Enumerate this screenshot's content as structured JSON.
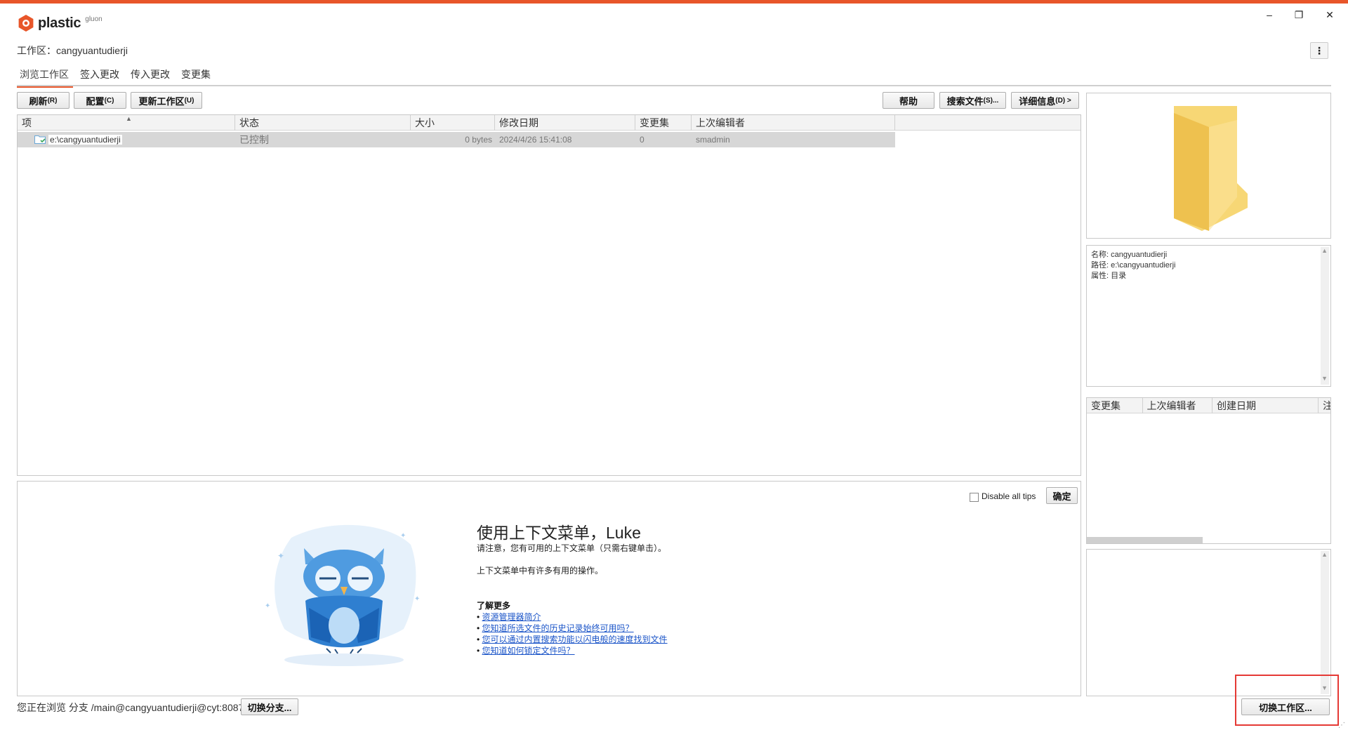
{
  "colors": {
    "accent": "#e8562a",
    "link": "#1a54c8",
    "highlight": "#e53935"
  },
  "app": {
    "logo_text": "plastic",
    "logo_sup": "gluon"
  },
  "window_controls": {
    "minimize": "–",
    "restore": "❐",
    "close": "✕"
  },
  "workspace": {
    "label": "工作区：",
    "name": "cangyuantudierji"
  },
  "tabs": [
    "浏览工作区",
    "签入更改",
    "传入更改",
    "变更集"
  ],
  "toolbar": {
    "refresh": "刷新",
    "refresh_key": "(R)",
    "config": "配置",
    "config_key": "(C)",
    "update": "更新工作区",
    "update_key": "(U)",
    "help": "帮助",
    "search": "搜索文件",
    "search_key": "(S)...",
    "details": "详细信息",
    "details_key": "(D) >"
  },
  "grid": {
    "columns": [
      "项",
      "状态",
      "大小",
      "修改日期",
      "变更集",
      "上次编辑者"
    ],
    "rows": [
      {
        "item": "e:\\cangyuantudierji",
        "status": "已控制",
        "size": "0 bytes",
        "modified": "2024/4/26 15:41:08",
        "changeset": "0",
        "editor": "smadmin"
      }
    ]
  },
  "tip": {
    "disable_label": "Disable all tips",
    "ok": "确定",
    "title": "使用上下文菜单，Luke",
    "line1": "请注意，您有可用的上下文菜单（只需右键单击）。",
    "line2": "上下文菜单中有许多有用的操作。",
    "learn_more": "了解更多",
    "bullet": "•",
    "links": [
      "资源管理器简介",
      "您知道所选文件的历史记录始终可用吗？",
      "您可以通过内置搜索功能以闪电般的速度找到文件",
      "您知道如何锁定文件吗？"
    ]
  },
  "details": {
    "name_label": "名称:",
    "name": "cangyuantudierji",
    "path_label": "路径:",
    "path": "e:\\cangyuantudierji",
    "attr_label": "属性:",
    "attr": "目录"
  },
  "history": {
    "columns": [
      "变更集",
      "上次编辑者",
      "创建日期",
      "注"
    ]
  },
  "status_bar": {
    "browsing": "您正在浏览 分支 /main@cangyuantudierji@cyt:8087",
    "switch_branch": "切换分支...",
    "switch_workspace": "切换工作区..."
  }
}
